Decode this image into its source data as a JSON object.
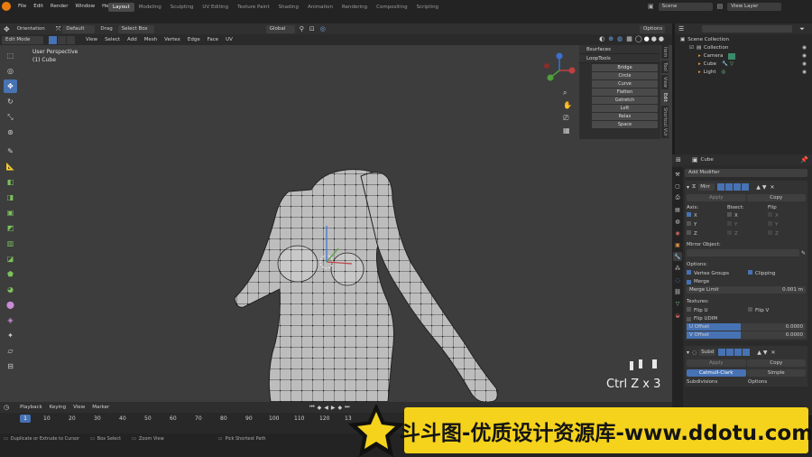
{
  "topmenu": {
    "file": "File",
    "edit": "Edit",
    "render": "Render",
    "window": "Window",
    "help": "Help",
    "workspaces": [
      "Layout",
      "Modeling",
      "Sculpting",
      "UV Editing",
      "Texture Paint",
      "Shading",
      "Animation",
      "Rendering",
      "Compositing",
      "Scripting"
    ],
    "scene": "Scene",
    "view_layer": "View Layer"
  },
  "toolheader": {
    "orientation": "Orientation",
    "default": "Default",
    "drag": "Drag",
    "select_box": "Select Box",
    "global": "Global",
    "options": "Options"
  },
  "modeheader": {
    "mode": "Edit Mode",
    "menus": [
      "View",
      "Select",
      "Add",
      "Mesh",
      "Vertex",
      "Edge",
      "Face",
      "UV"
    ]
  },
  "viewport": {
    "perspective": "User Perspective",
    "object": "(1) Cube",
    "shortcut_overlay": "Ctrl Z x 3"
  },
  "npanel": {
    "bsurfaces": "Bsurfaces",
    "looptools": "LoopTools",
    "buttons": [
      "Bridge",
      "Circle",
      "Curve",
      "Flatten",
      "Gstretch",
      "Loft",
      "Relax",
      "Space"
    ],
    "tabs": [
      "Item",
      "Tool",
      "View",
      "Edit",
      "Shortcut VUr"
    ]
  },
  "outliner": {
    "scene_collection": "Scene Collection",
    "collection": "Collection",
    "items": [
      "Camera",
      "Cube",
      "Light"
    ]
  },
  "properties": {
    "object": "Cube",
    "add_modifier": "Add Modifier",
    "mirror_name": "Mirr",
    "apply": "Apply",
    "copy": "Copy",
    "axis": "Axis:",
    "bisect": "Bisect:",
    "flip": "Flip",
    "x": "X",
    "y": "Y",
    "z": "Z",
    "mirror_object": "Mirror Object:",
    "options": "Options:",
    "vertex_groups": "Vertex Groups",
    "clipping": "Clipping",
    "merge": "Merge",
    "merge_limit": "Merge Limit",
    "merge_limit_value": "0.001 m",
    "textures": "Textures:",
    "flip_u": "Flip U",
    "flip_v": "Flip V",
    "flip_udim": "Flip UDIM",
    "u_offset": "U Offset",
    "v_offset": "V Offset",
    "u_offset_value": "0.0000",
    "v_offset_value": "0.0000",
    "subd_name": "Subd",
    "catmull_clark": "Catmull-Clark",
    "simple": "Simple",
    "subdivisions": "Subdivisions",
    "options2": "Options"
  },
  "timeline": {
    "playback": "Playback",
    "keying": "Keying",
    "view": "View",
    "marker": "Marker",
    "current_frame": "1",
    "frames": [
      "10",
      "20",
      "30",
      "40",
      "50",
      "60",
      "70",
      "80",
      "90",
      "100",
      "110",
      "120",
      "13"
    ]
  },
  "statusbar": {
    "hint1": "Duplicate or Extrude to Cursor",
    "hint2": "Box Select",
    "hint3": "Zoom View",
    "hint4": "Pick Shortest Path"
  },
  "watermark": {
    "text": "斗斗图-优质设计资源库-www.ddotu.com"
  },
  "colors": {
    "accent": "#4772b3",
    "viewport_bg": "#3d3d3d",
    "watermark_yellow": "#f5d31c"
  }
}
